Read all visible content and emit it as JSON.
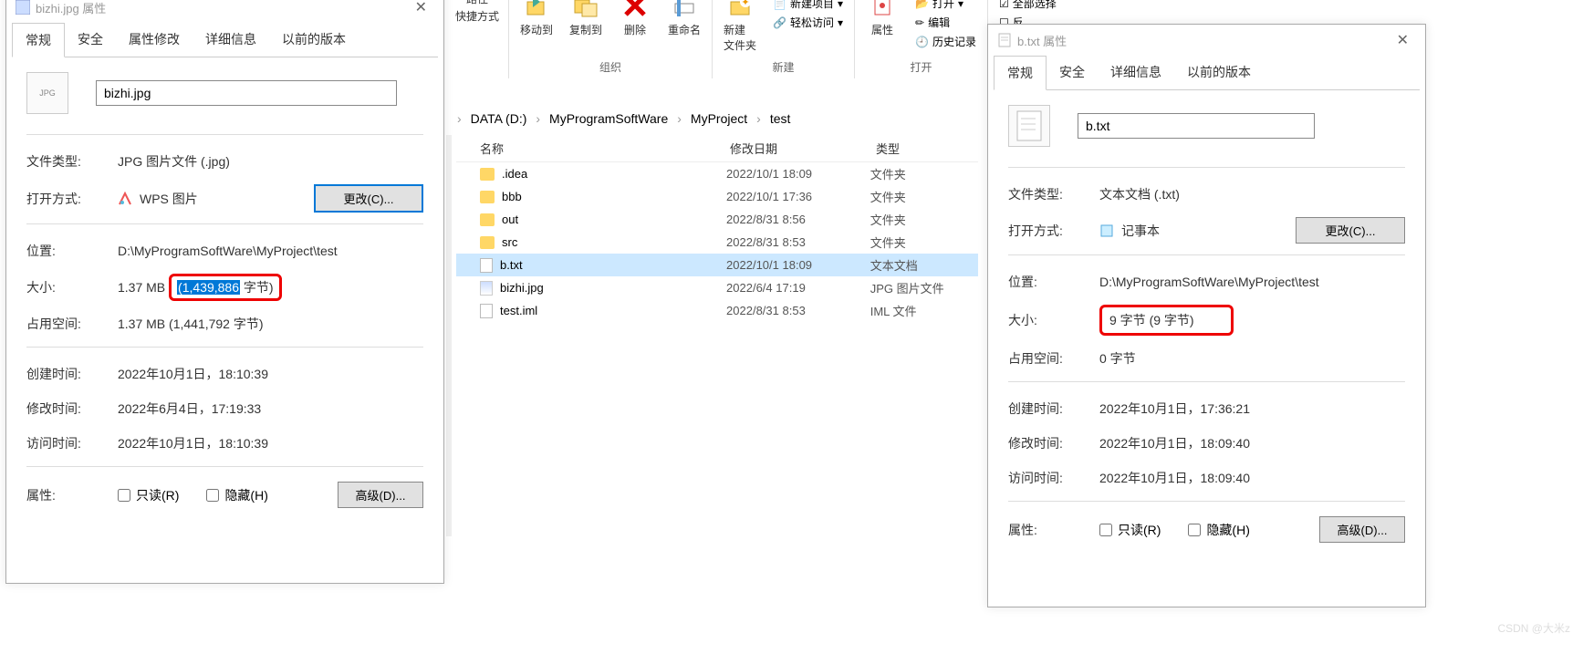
{
  "left_dialog": {
    "title": "bizhi.jpg 属性",
    "tabs": [
      "常规",
      "安全",
      "属性修改",
      "详细信息",
      "以前的版本"
    ],
    "filename": "bizhi.jpg",
    "thumb_label": "JPG",
    "file_type_label": "文件类型:",
    "file_type": "JPG 图片文件 (.jpg)",
    "open_with_label": "打开方式:",
    "open_with": "WPS 图片",
    "change_btn": "更改(C)...",
    "location_label": "位置:",
    "location": "D:\\MyProgramSoftWare\\MyProject\\test",
    "size_label": "大小:",
    "size_prefix": "1.37 MB ",
    "size_hl": "(1,439,886",
    "size_suffix": " 字节)",
    "disk_label": "占用空间:",
    "disk": "1.37 MB (1,441,792 字节)",
    "created_label": "创建时间:",
    "created": "2022年10月1日，18:10:39",
    "modified_label": "修改时间:",
    "modified": "2022年6月4日，17:19:33",
    "accessed_label": "访问时间:",
    "accessed": "2022年10月1日，18:10:39",
    "attr_label": "属性:",
    "readonly": "只读(R)",
    "hidden": "隐藏(H)",
    "advanced": "高级(D)..."
  },
  "right_dialog": {
    "title": "b.txt 属性",
    "tabs": [
      "常规",
      "安全",
      "详细信息",
      "以前的版本"
    ],
    "filename": "b.txt",
    "file_type_label": "文件类型:",
    "file_type": "文本文档 (.txt)",
    "open_with_label": "打开方式:",
    "open_with": "记事本",
    "change_btn": "更改(C)...",
    "location_label": "位置:",
    "location": "D:\\MyProgramSoftWare\\MyProject\\test",
    "size_label": "大小:",
    "size": "9 字节 (9 字节)",
    "disk_label": "占用空间:",
    "disk": "0 字节",
    "created_label": "创建时间:",
    "created": "2022年10月1日，17:36:21",
    "modified_label": "修改时间:",
    "modified": "2022年10月1日，18:09:40",
    "accessed_label": "访问时间:",
    "accessed": "2022年10月1日，18:09:40",
    "attr_label": "属性:",
    "readonly": "只读(R)",
    "hidden": "隐藏(H)",
    "advanced": "高级(D)..."
  },
  "ribbon": {
    "clip_sub": "快捷方式",
    "path_sub": "路径",
    "moveto": "移动到",
    "copyto": "复制到",
    "delete": "删除",
    "rename": "重命名",
    "newfolder": "新建\n文件夹",
    "newitem": "新建项目",
    "easyaccess": "轻松访问",
    "properties": "属性",
    "open": "打开",
    "edit": "编辑",
    "history": "历史记录",
    "selectall": "全部选择",
    "inverse": "反",
    "g_org": "组织",
    "g_new": "新建",
    "g_open": "打开"
  },
  "breadcrumb": {
    "disk": "DATA (D:)",
    "p1": "MyProgramSoftWare",
    "p2": "MyProject",
    "p3": "test"
  },
  "list": {
    "h_name": "名称",
    "h_date": "修改日期",
    "h_type": "类型",
    "rows": [
      {
        "name": ".idea",
        "date": "2022/10/1 18:09",
        "type": "文件夹",
        "kind": "folder"
      },
      {
        "name": "bbb",
        "date": "2022/10/1 17:36",
        "type": "文件夹",
        "kind": "folder"
      },
      {
        "name": "out",
        "date": "2022/8/31 8:56",
        "type": "文件夹",
        "kind": "folder"
      },
      {
        "name": "src",
        "date": "2022/8/31 8:53",
        "type": "文件夹",
        "kind": "folder"
      },
      {
        "name": "b.txt",
        "date": "2022/10/1 18:09",
        "type": "文本文档",
        "kind": "txt",
        "sel": true
      },
      {
        "name": "bizhi.jpg",
        "date": "2022/6/4 17:19",
        "type": "JPG 图片文件",
        "kind": "img"
      },
      {
        "name": "test.iml",
        "date": "2022/8/31 8:53",
        "type": "IML 文件",
        "kind": "txt"
      }
    ]
  },
  "watermark": "CSDN @大米z"
}
